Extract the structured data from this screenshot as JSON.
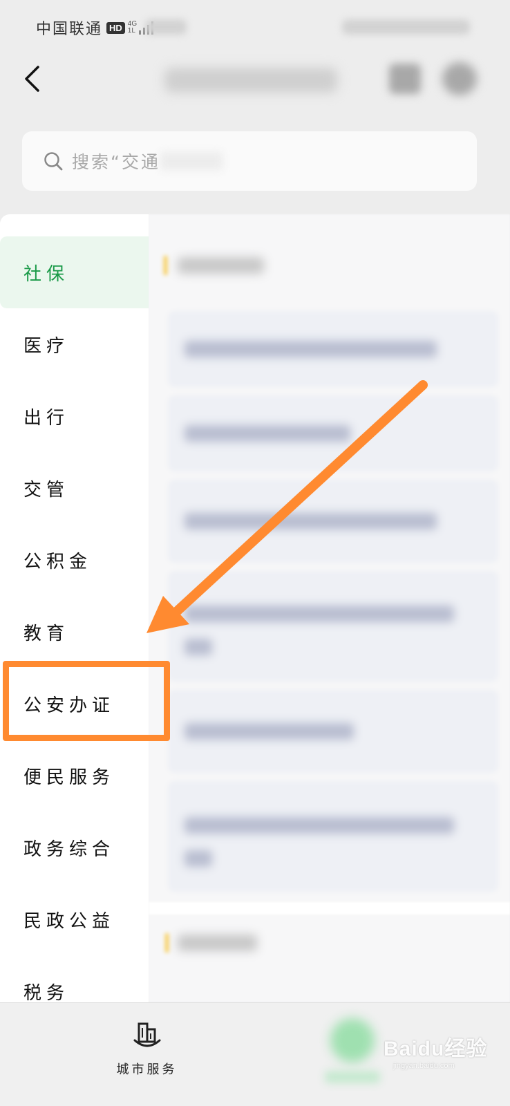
{
  "status_bar": {
    "carrier": "中国联通",
    "hd_badge": "HD",
    "network_type": "4G",
    "network_sub": "1L"
  },
  "header": {
    "back_icon": "chevron-left-icon"
  },
  "search": {
    "placeholder": "搜索“交通",
    "icon": "search-icon"
  },
  "sidebar": {
    "active_color": "#1a9a48",
    "items": [
      {
        "label": "社保",
        "active": true
      },
      {
        "label": "医疗"
      },
      {
        "label": "出行"
      },
      {
        "label": "交管"
      },
      {
        "label": "公积金"
      },
      {
        "label": "教育"
      },
      {
        "label": "公安办证",
        "highlighted": true
      },
      {
        "label": "便民服务"
      },
      {
        "label": "政务综合"
      },
      {
        "label": "民政公益"
      },
      {
        "label": "税务"
      }
    ]
  },
  "annotation": {
    "color": "#ff8a30",
    "arrow_icon": "arrow-pointing-to-gongan-icon"
  },
  "tab_bar": {
    "city_service_label": "城市服务",
    "city_service_icon": "city-buildings-icon"
  },
  "watermark": {
    "text": "Baidu经验",
    "sub": "jingyan.baidu.com"
  }
}
